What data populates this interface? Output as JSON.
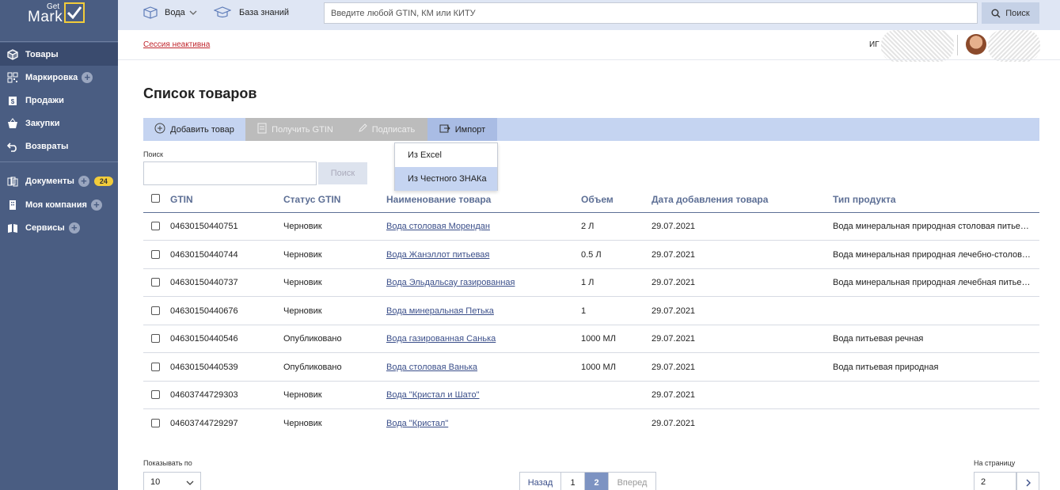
{
  "logo": {
    "get": "Get",
    "mark": "Mark"
  },
  "sidebar": {
    "items": [
      {
        "label": "Товары",
        "icon": "box-icon",
        "plus": false
      },
      {
        "label": "Маркировка",
        "icon": "qr-code-icon",
        "plus": true
      },
      {
        "label": "Продажи",
        "icon": "receipt-icon",
        "plus": false
      },
      {
        "label": "Закупки",
        "icon": "basket-icon",
        "plus": false
      },
      {
        "label": "Возвраты",
        "icon": "return-icon",
        "plus": false
      },
      {
        "label": "Документы",
        "icon": "documents-icon",
        "plus": true,
        "badge": "24"
      },
      {
        "label": "Моя компания",
        "icon": "building-icon",
        "plus": true
      },
      {
        "label": "Сервисы",
        "icon": "book-icon",
        "plus": true
      }
    ]
  },
  "topbar": {
    "category": "Вода",
    "knowledge": "База знаний",
    "search_placeholder": "Введите любой GTIN, КМ или КИТУ",
    "search_button": "Поиск"
  },
  "session": {
    "text": "Сессия неактивна",
    "user_initials": "ИГ"
  },
  "page": {
    "title": "Список товаров"
  },
  "toolbar": {
    "add": "Добавить товар",
    "get_gtin": "Получить GTIN",
    "sign": "Подписать",
    "import": "Импорт"
  },
  "import_menu": {
    "excel": "Из Excel",
    "znak": "Из Честного ЗНАКа"
  },
  "filter": {
    "label": "Поиск",
    "button": "Поиск"
  },
  "table": {
    "headers": [
      "GTIN",
      "Статус GTIN",
      "Наименование товара",
      "Объем",
      "Дата добавления товара",
      "Тип продукта"
    ],
    "rows": [
      {
        "gtin": "04630150440751",
        "status": "Черновик",
        "name": "Вода столовая Морендан",
        "volume": "2 Л",
        "date": "29.07.2021",
        "type": "Вода минеральная природная столовая питьевая"
      },
      {
        "gtin": "04630150440744",
        "status": "Черновик",
        "name": "Вода Жанэллот питьевая",
        "volume": "0.5 Л",
        "date": "29.07.2021",
        "type": "Вода минеральная природная лечебно-столовая"
      },
      {
        "gtin": "04630150440737",
        "status": "Черновик",
        "name": "Вода Эльдальсау газированная",
        "volume": "1 Л",
        "date": "29.07.2021",
        "type": "Вода минеральная природная лечебная питьевая"
      },
      {
        "gtin": "04630150440676",
        "status": "Черновик",
        "name": "Вода минеральная Петька",
        "volume": "1",
        "date": "29.07.2021",
        "type": ""
      },
      {
        "gtin": "04630150440546",
        "status": "Опубликовано",
        "name": "Вода газированная Санька",
        "volume": "1000 МЛ",
        "date": "29.07.2021",
        "type": "Вода питьевая речная"
      },
      {
        "gtin": "04630150440539",
        "status": "Опубликовано",
        "name": "Вода столовая Ванька",
        "volume": "1000 МЛ",
        "date": "29.07.2021",
        "type": "Вода питьевая природная"
      },
      {
        "gtin": "04603744729303",
        "status": "Черновик",
        "name": "Вода \"Кристал и Шато\"",
        "volume": "",
        "date": "29.07.2021",
        "type": ""
      },
      {
        "gtin": "04603744729297",
        "status": "Черновик",
        "name": "Вода \"Кристал\"",
        "volume": "",
        "date": "29.07.2021",
        "type": ""
      }
    ]
  },
  "footer": {
    "per_page_label": "Показывать по",
    "per_page_value": "10",
    "prev": "Назад",
    "pages": [
      "1",
      "2"
    ],
    "current_page": "2",
    "next": "Вперед",
    "goto_label": "На страницу",
    "goto_value": "2"
  },
  "colors": {
    "sidebar": "#4a5d82",
    "accent": "#c5d4f1",
    "badge": "#f2cc3a",
    "session_error": "#c0262d"
  }
}
